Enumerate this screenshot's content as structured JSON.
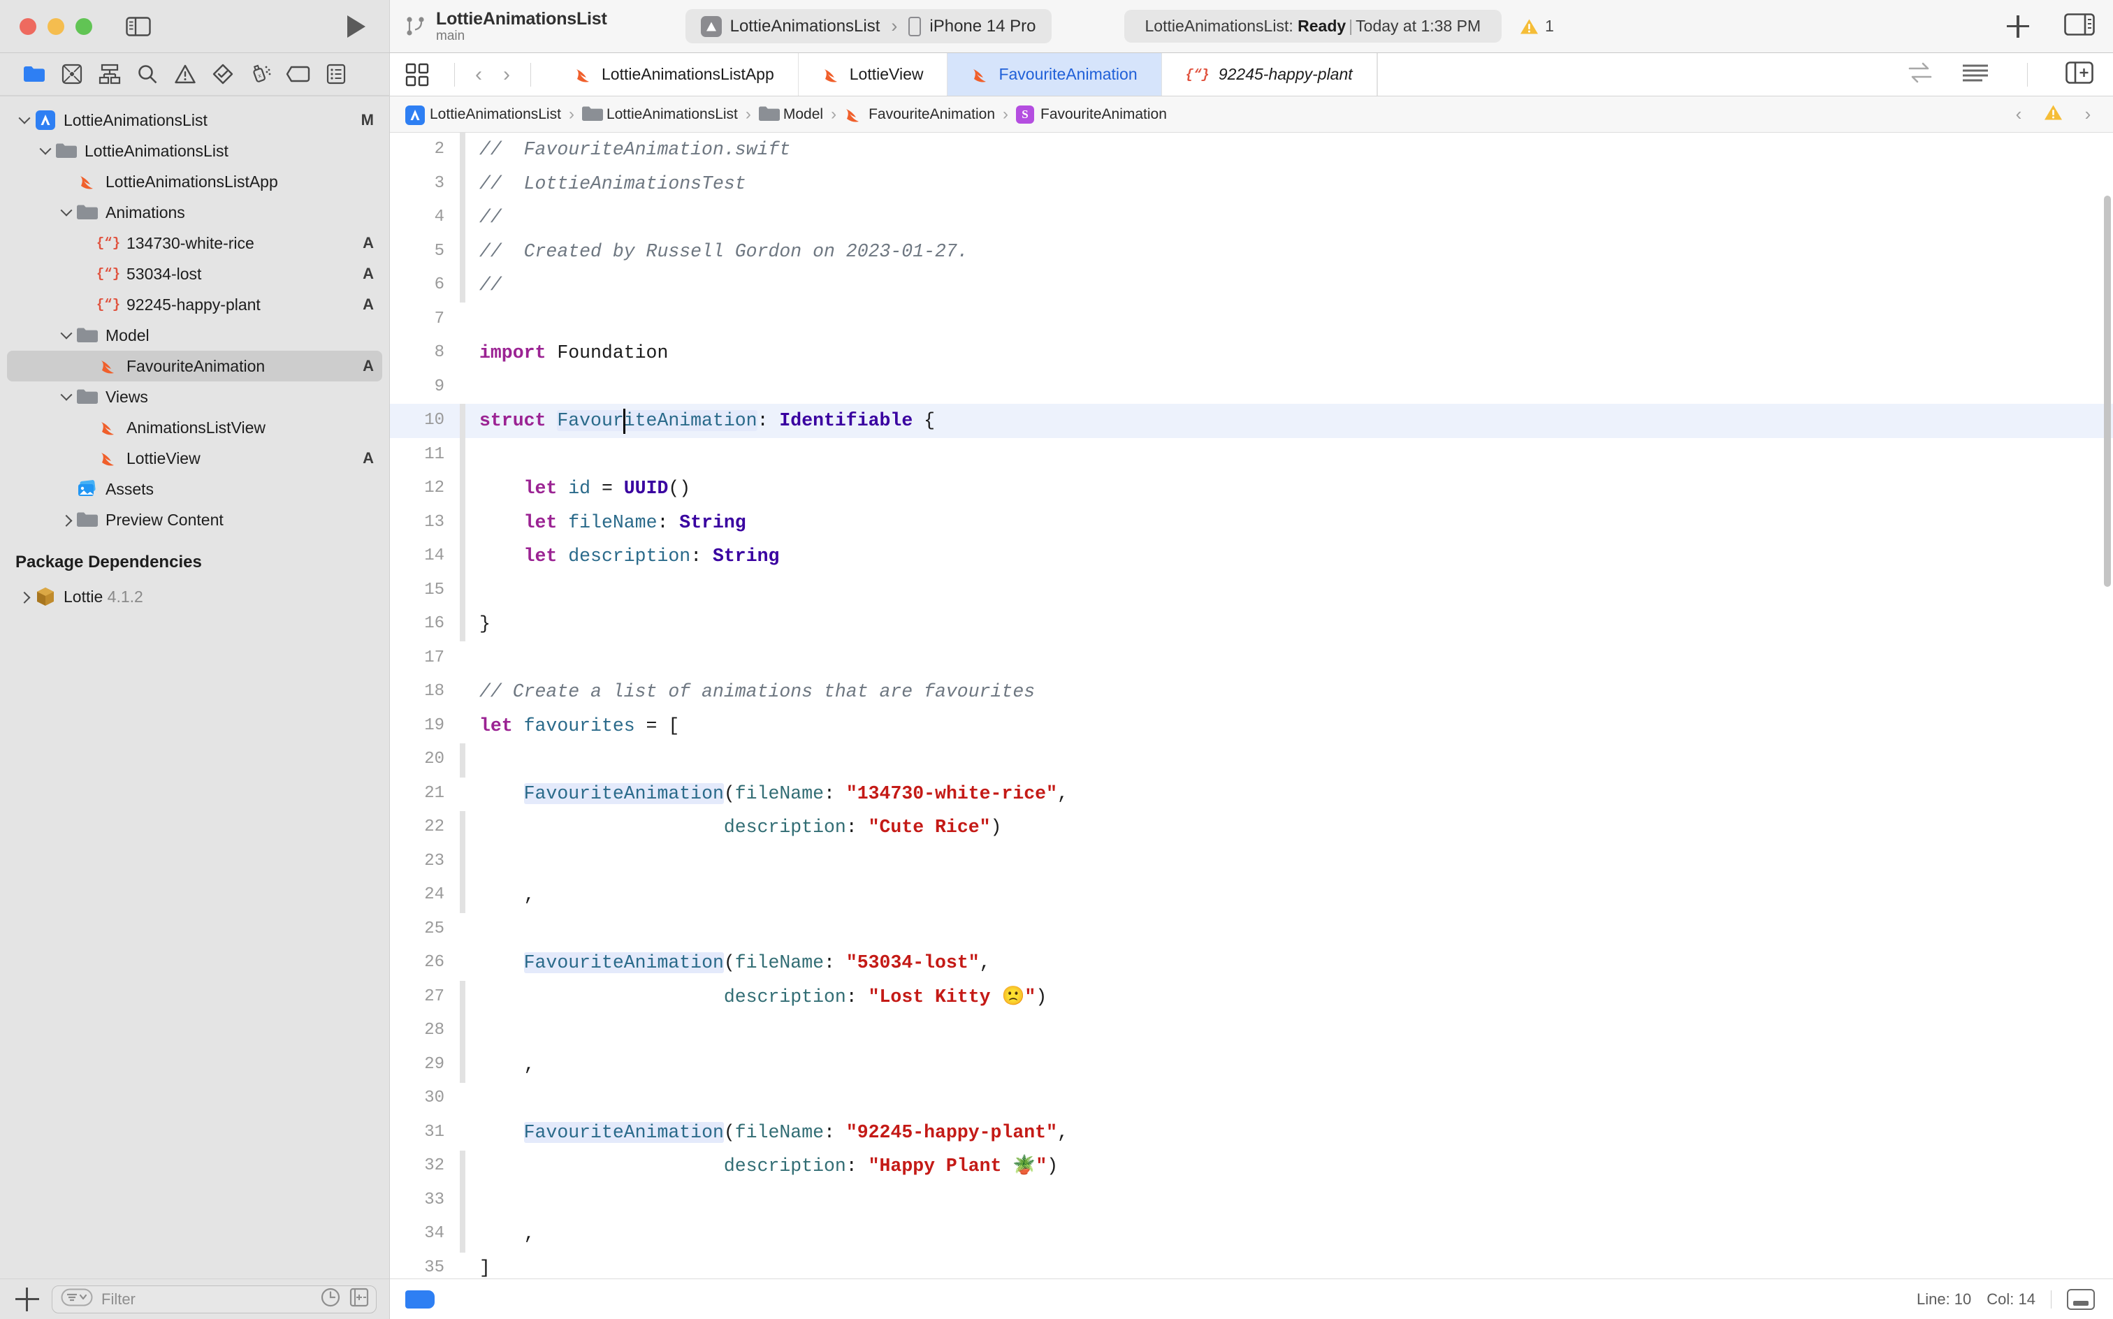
{
  "window": {
    "scheme_title": "LottieAnimationsList",
    "branch": "main",
    "destination_project": "LottieAnimationsList",
    "destination_device": "iPhone 14 Pro",
    "status_prefix": "LottieAnimationsList:",
    "status_state": "Ready",
    "status_time": "Today at 1:38 PM",
    "warning_count": "1",
    "separator": "›"
  },
  "navigator_toolbar": {
    "icons": [
      "folder-icon",
      "source-control-icon",
      "symbol-hierarchy-icon",
      "search-icon",
      "issue-navigator-icon",
      "test-navigator-icon",
      "debug-navigator-icon",
      "breakpoint-navigator-icon",
      "report-navigator-icon"
    ]
  },
  "tabs": [
    {
      "label": "LottieAnimationsListApp",
      "icon": "swift-file-icon",
      "active": false,
      "italic": false
    },
    {
      "label": "LottieView",
      "icon": "swift-file-icon",
      "active": false,
      "italic": false
    },
    {
      "label": "FavouriteAnimation",
      "icon": "swift-file-icon",
      "active": true,
      "italic": false
    },
    {
      "label": "92245-happy-plant",
      "icon": "json-file-icon",
      "active": false,
      "italic": true
    }
  ],
  "tabbar_right_icons": [
    "code-review-icon",
    "editor-options-icon",
    "add-editor-icon"
  ],
  "navigator": {
    "rows": [
      {
        "label": "LottieAnimationsList",
        "indent": 0,
        "disclosure": "open",
        "icon": "xcode-project-icon",
        "badge": "M",
        "selected": false
      },
      {
        "label": "LottieAnimationsList",
        "indent": 1,
        "disclosure": "open",
        "icon": "folder-icon",
        "badge": "",
        "selected": false
      },
      {
        "label": "LottieAnimationsListApp",
        "indent": 2,
        "disclosure": "none",
        "icon": "swift-file-icon",
        "badge": "",
        "selected": false
      },
      {
        "label": "Animations",
        "indent": 2,
        "disclosure": "open",
        "icon": "folder-icon",
        "badge": "",
        "selected": false
      },
      {
        "label": "134730-white-rice",
        "indent": 3,
        "disclosure": "none",
        "icon": "json-file-icon",
        "badge": "A",
        "selected": false
      },
      {
        "label": "53034-lost",
        "indent": 3,
        "disclosure": "none",
        "icon": "json-file-icon",
        "badge": "A",
        "selected": false
      },
      {
        "label": "92245-happy-plant",
        "indent": 3,
        "disclosure": "none",
        "icon": "json-file-icon",
        "badge": "A",
        "selected": false
      },
      {
        "label": "Model",
        "indent": 2,
        "disclosure": "open",
        "icon": "folder-icon",
        "badge": "",
        "selected": false
      },
      {
        "label": "FavouriteAnimation",
        "indent": 3,
        "disclosure": "none",
        "icon": "swift-file-icon",
        "badge": "A",
        "selected": true
      },
      {
        "label": "Views",
        "indent": 2,
        "disclosure": "open",
        "icon": "folder-icon",
        "badge": "",
        "selected": false
      },
      {
        "label": "AnimationsListView",
        "indent": 3,
        "disclosure": "none",
        "icon": "swift-file-icon",
        "badge": "",
        "selected": false
      },
      {
        "label": "LottieView",
        "indent": 3,
        "disclosure": "none",
        "icon": "swift-file-icon",
        "badge": "A",
        "selected": false
      },
      {
        "label": "Assets",
        "indent": 2,
        "disclosure": "none",
        "icon": "assets-catalog-icon",
        "badge": "",
        "selected": false
      },
      {
        "label": "Preview Content",
        "indent": 2,
        "disclosure": "closed",
        "icon": "folder-icon",
        "badge": "",
        "selected": false
      }
    ],
    "section_title": "Package Dependencies",
    "package": {
      "name": "Lottie",
      "version": "4.1.2",
      "icon": "package-icon"
    },
    "filter_placeholder": "Filter",
    "footer_icons": [
      "add-icon",
      "filter-options-icon",
      "recent-icon",
      "source-control-filter-icon"
    ]
  },
  "jumpbar": {
    "crumbs": [
      {
        "label": "LottieAnimationsList",
        "icon": "xcode-project-icon"
      },
      {
        "label": "LottieAnimationsList",
        "icon": "folder-icon"
      },
      {
        "label": "Model",
        "icon": "folder-icon"
      },
      {
        "label": "FavouriteAnimation",
        "icon": "swift-file-icon"
      },
      {
        "label": "FavouriteAnimation",
        "icon": "struct-symbol-icon"
      }
    ],
    "separator": "›",
    "right_icons": [
      "previous-issue-icon",
      "warning-icon",
      "next-issue-icon"
    ]
  },
  "code": {
    "first_visible_line": 2,
    "cursor_line": 10,
    "lines": [
      {
        "n": 2,
        "tokens": [
          [
            "c-com",
            "//  FavouriteAnimation.swift"
          ]
        ]
      },
      {
        "n": 3,
        "tokens": [
          [
            "c-com",
            "//  LottieAnimationsTest"
          ]
        ]
      },
      {
        "n": 4,
        "tokens": [
          [
            "c-com",
            "//"
          ]
        ]
      },
      {
        "n": 5,
        "tokens": [
          [
            "c-com",
            "//  Created by Russell Gordon on 2023-01-27."
          ]
        ]
      },
      {
        "n": 6,
        "tokens": [
          [
            "c-com",
            "//"
          ]
        ]
      },
      {
        "n": 7,
        "tokens": []
      },
      {
        "n": 8,
        "tokens": [
          [
            "c-kw",
            "import"
          ],
          [
            "c-plain",
            " Foundation"
          ]
        ]
      },
      {
        "n": 9,
        "tokens": []
      },
      {
        "n": 10,
        "hl": true,
        "tokens": [
          [
            "c-kw",
            "struct"
          ],
          [
            "c-plain",
            " "
          ],
          [
            "c-decl hlbox",
            "FavouriteAnimation"
          ],
          [
            "c-plain",
            ": "
          ],
          [
            "c-type",
            "Identifiable"
          ],
          [
            "c-plain",
            " {"
          ]
        ]
      },
      {
        "n": 11,
        "tokens": []
      },
      {
        "n": 12,
        "tokens": [
          [
            "c-plain",
            "    "
          ],
          [
            "c-kw",
            "let"
          ],
          [
            "c-plain",
            " "
          ],
          [
            "c-decl",
            "id"
          ],
          [
            "c-plain",
            " = "
          ],
          [
            "c-type",
            "UUID"
          ],
          [
            "c-plain",
            "()"
          ]
        ]
      },
      {
        "n": 13,
        "tokens": [
          [
            "c-plain",
            "    "
          ],
          [
            "c-kw",
            "let"
          ],
          [
            "c-plain",
            " "
          ],
          [
            "c-decl",
            "fileName"
          ],
          [
            "c-plain",
            ": "
          ],
          [
            "c-type",
            "String"
          ]
        ]
      },
      {
        "n": 14,
        "tokens": [
          [
            "c-plain",
            "    "
          ],
          [
            "c-kw",
            "let"
          ],
          [
            "c-plain",
            " "
          ],
          [
            "c-decl",
            "description"
          ],
          [
            "c-plain",
            ": "
          ],
          [
            "c-type",
            "String"
          ]
        ]
      },
      {
        "n": 15,
        "tokens": []
      },
      {
        "n": 16,
        "tokens": [
          [
            "c-plain",
            "}"
          ]
        ]
      },
      {
        "n": 17,
        "tokens": []
      },
      {
        "n": 18,
        "tokens": [
          [
            "c-com",
            "// Create a list of animations that are favourites"
          ]
        ]
      },
      {
        "n": 19,
        "tokens": [
          [
            "c-kw",
            "let"
          ],
          [
            "c-plain",
            " "
          ],
          [
            "c-decl",
            "favourites"
          ],
          [
            "c-plain",
            " = ["
          ]
        ]
      },
      {
        "n": 20,
        "tokens": []
      },
      {
        "n": 21,
        "tokens": [
          [
            "c-plain",
            "    "
          ],
          [
            "c-decl hlbox",
            "FavouriteAnimation"
          ],
          [
            "c-plain",
            "("
          ],
          [
            "c-prop",
            "fileName"
          ],
          [
            "c-plain",
            ": "
          ],
          [
            "c-str",
            "\"134730-white-rice\""
          ],
          [
            "c-plain",
            ","
          ]
        ]
      },
      {
        "n": 22,
        "tokens": [
          [
            "c-plain",
            "                      "
          ],
          [
            "c-prop",
            "description"
          ],
          [
            "c-plain",
            ": "
          ],
          [
            "c-str",
            "\"Cute Rice\""
          ],
          [
            "c-plain",
            ")"
          ]
        ]
      },
      {
        "n": 23,
        "tokens": []
      },
      {
        "n": 24,
        "tokens": [
          [
            "c-plain",
            "    ,"
          ]
        ]
      },
      {
        "n": 25,
        "tokens": []
      },
      {
        "n": 26,
        "tokens": [
          [
            "c-plain",
            "    "
          ],
          [
            "c-decl hlbox",
            "FavouriteAnimation"
          ],
          [
            "c-plain",
            "("
          ],
          [
            "c-prop",
            "fileName"
          ],
          [
            "c-plain",
            ": "
          ],
          [
            "c-str",
            "\"53034-lost\""
          ],
          [
            "c-plain",
            ","
          ]
        ]
      },
      {
        "n": 27,
        "tokens": [
          [
            "c-plain",
            "                      "
          ],
          [
            "c-prop",
            "description"
          ],
          [
            "c-plain",
            ": "
          ],
          [
            "c-str",
            "\"Lost Kitty 🙁\""
          ],
          [
            "c-plain",
            ")"
          ]
        ]
      },
      {
        "n": 28,
        "tokens": []
      },
      {
        "n": 29,
        "tokens": [
          [
            "c-plain",
            "    ,"
          ]
        ]
      },
      {
        "n": 30,
        "tokens": []
      },
      {
        "n": 31,
        "tokens": [
          [
            "c-plain",
            "    "
          ],
          [
            "c-decl hlbox",
            "FavouriteAnimation"
          ],
          [
            "c-plain",
            "("
          ],
          [
            "c-prop",
            "fileName"
          ],
          [
            "c-plain",
            ": "
          ],
          [
            "c-str",
            "\"92245-happy-plant\""
          ],
          [
            "c-plain",
            ","
          ]
        ]
      },
      {
        "n": 32,
        "tokens": [
          [
            "c-plain",
            "                      "
          ],
          [
            "c-prop",
            "description"
          ],
          [
            "c-plain",
            ": "
          ],
          [
            "c-str",
            "\"Happy Plant 🪴\""
          ],
          [
            "c-plain",
            ")"
          ]
        ]
      },
      {
        "n": 33,
        "tokens": []
      },
      {
        "n": 34,
        "tokens": [
          [
            "c-plain",
            "    ,"
          ]
        ]
      },
      {
        "n": 35,
        "tokens": [
          [
            "c-plain",
            "]"
          ]
        ]
      }
    ]
  },
  "statusbar": {
    "line_label": "Line: 10",
    "col_label": "Col: 14"
  },
  "colors": {
    "accent": "#2e7ff3",
    "tab_active_bg": "#d6e4fb",
    "tab_active_text": "#2060d8",
    "swift_orange": "#f05f2b",
    "string_red": "#c41a16",
    "keyword_purple": "#9b2393",
    "type_indigo": "#3900a0",
    "warning_yellow": "#f5bd37",
    "comment_gray": "#6e7781"
  }
}
